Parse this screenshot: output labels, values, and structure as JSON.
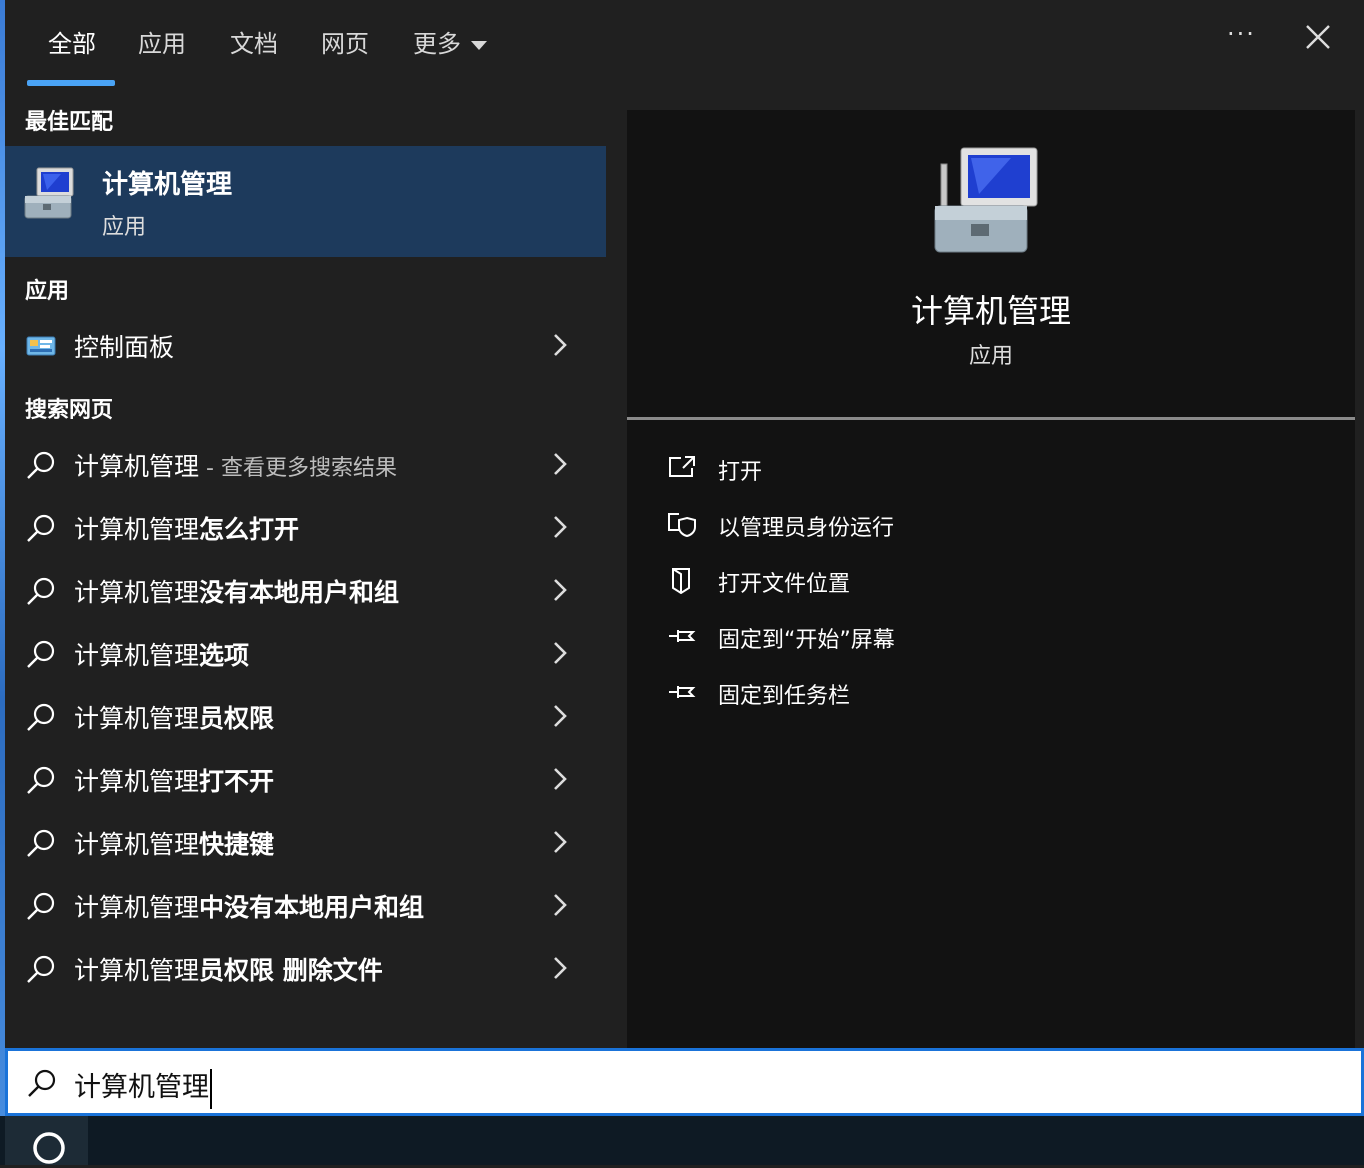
{
  "tabs": [
    {
      "label": "全部",
      "active": true
    },
    {
      "label": "应用"
    },
    {
      "label": "文档"
    },
    {
      "label": "网页"
    },
    {
      "label": "更多"
    }
  ],
  "header": {
    "more_options": "···"
  },
  "left": {
    "best_match_heading": "最佳匹配",
    "best_match": {
      "title": "计算机管理",
      "subtitle": "应用",
      "icon": "computer-management-icon"
    },
    "apps_heading": "应用",
    "apps": [
      {
        "label": "控制面板",
        "icon": "control-panel-icon"
      }
    ],
    "web_heading": "搜索网页",
    "web_results": [
      {
        "prefix": "计算机管理",
        "bold": "",
        "suffix": " - 查看更多搜索结果"
      },
      {
        "prefix": "计算机管理",
        "bold": "怎么打开",
        "suffix": ""
      },
      {
        "prefix": "计算机管理",
        "bold": "没有本地用户和组",
        "suffix": ""
      },
      {
        "prefix": "计算机管理",
        "bold": "选项",
        "suffix": ""
      },
      {
        "prefix": "计算机管理",
        "bold": "员权限",
        "suffix": ""
      },
      {
        "prefix": "计算机管理",
        "bold": "打不开",
        "suffix": ""
      },
      {
        "prefix": "计算机管理",
        "bold": "快捷键",
        "suffix": ""
      },
      {
        "prefix": "计算机管理",
        "bold": "中没有本地用户和组",
        "suffix": ""
      },
      {
        "prefix": "计算机管理",
        "bold": "员权限 删除文件",
        "suffix": ""
      }
    ]
  },
  "right": {
    "title": "计算机管理",
    "subtitle": "应用",
    "actions": [
      {
        "label": "打开",
        "icon": "open-icon"
      },
      {
        "label": "以管理员身份运行",
        "icon": "shield-icon"
      },
      {
        "label": "打开文件位置",
        "icon": "file-location-icon"
      },
      {
        "label": "固定到“开始”屏幕",
        "icon": "pin-icon"
      },
      {
        "label": "固定到任务栏",
        "icon": "pin-icon"
      }
    ]
  },
  "search": {
    "value": "计算机管理"
  },
  "colors": {
    "accent": "#4aa3f5",
    "selected_bg": "#1d3a5c",
    "panel_bg": "#202020",
    "preview_bg": "#121212",
    "search_border": "#1a73d9"
  }
}
